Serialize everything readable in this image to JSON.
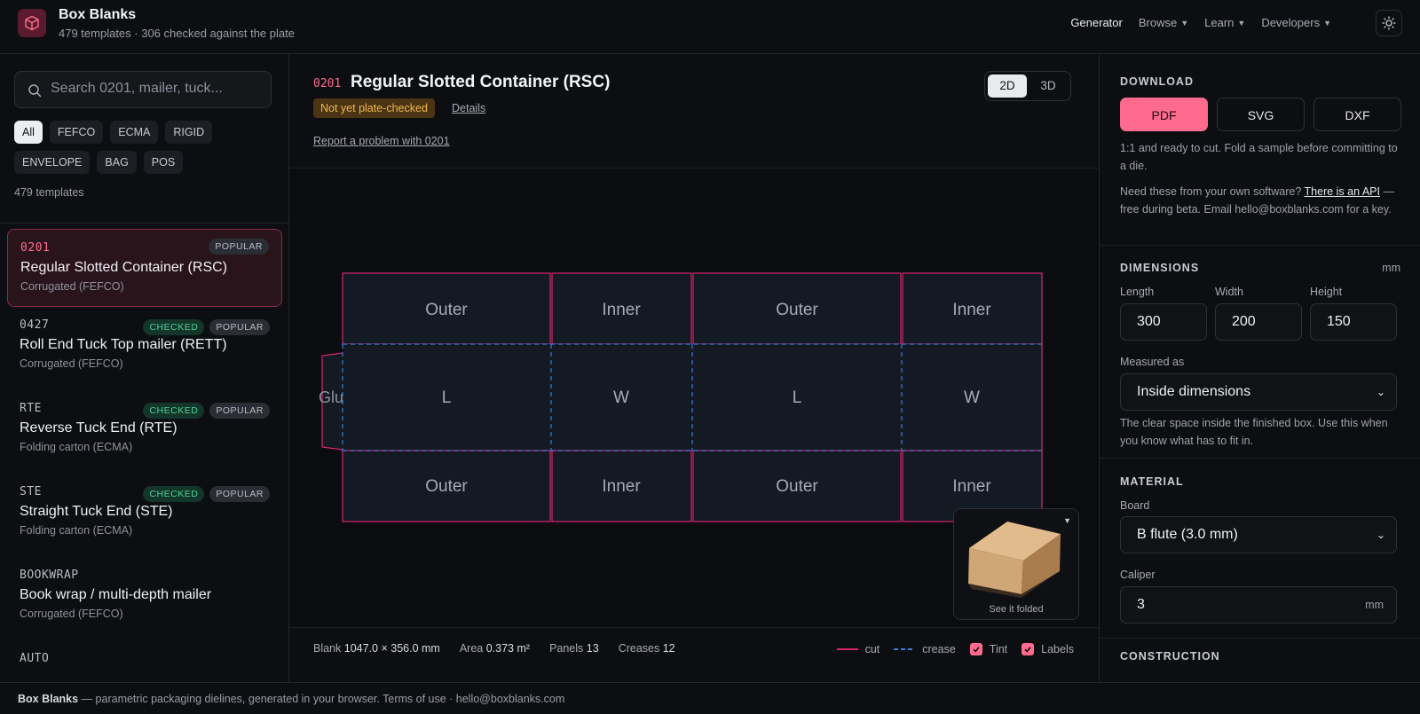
{
  "header": {
    "title": "Box Blanks",
    "subtitle": "479 templates · 306 checked against the plate",
    "nav": [
      {
        "label": "Generator",
        "active": true,
        "dropdown": false
      },
      {
        "label": "Browse",
        "dropdown": true
      },
      {
        "label": "Learn",
        "dropdown": true
      },
      {
        "label": "Developers",
        "dropdown": true
      }
    ],
    "theme_icon": "sun-icon"
  },
  "sidebar": {
    "search_placeholder": "Search 0201, mailer, tuck...",
    "filters": [
      "All",
      "FEFCO",
      "ECMA",
      "RIGID",
      "ENVELOPE",
      "BAG",
      "POS"
    ],
    "active_filter": "All",
    "count": "479 templates",
    "items": [
      {
        "code": "0201",
        "name": "Regular Slotted Container (RSC)",
        "category": "Corrugated (FEFCO)",
        "checked": "",
        "popular": "POPULAR",
        "selected": true
      },
      {
        "code": "0427",
        "name": "Roll End Tuck Top mailer (RETT)",
        "category": "Corrugated (FEFCO)",
        "checked": "CHECKED",
        "popular": "POPULAR"
      },
      {
        "code": "RTE",
        "name": "Reverse Tuck End (RTE)",
        "category": "Folding carton (ECMA)",
        "checked": "CHECKED",
        "popular": "POPULAR"
      },
      {
        "code": "STE",
        "name": "Straight Tuck End (STE)",
        "category": "Folding carton (ECMA)",
        "checked": "CHECKED",
        "popular": "POPULAR"
      },
      {
        "code": "BOOKWRAP",
        "name": "Book wrap / multi-depth mailer",
        "category": "Corrugated (FEFCO)",
        "checked": "",
        "popular": ""
      },
      {
        "code": "AUTO",
        "name": "",
        "category": "",
        "checked": "",
        "popular": ""
      }
    ]
  },
  "main": {
    "code": "0201",
    "title": "Regular Slotted Container (RSC)",
    "status_badge": "Not yet plate-checked",
    "details_link": "Details",
    "report_link": "Report a problem with 0201",
    "view_modes": [
      "2D",
      "3D"
    ],
    "active_view": "2D",
    "dieline": {
      "top_flaps": [
        "Outer",
        "Inner",
        "Outer",
        "Inner"
      ],
      "body_panels": [
        "L",
        "W",
        "L",
        "W"
      ],
      "bottom_flaps": [
        "Outer",
        "Inner",
        "Outer",
        "Inner"
      ],
      "glue_label": "Glue",
      "cut_color": "#d6266e",
      "crease_color": "#3a7bd5",
      "panel_fill": "#141a24"
    },
    "preview_caption": "See it folded",
    "stats": {
      "blank_label": "Blank",
      "blank_value": "1047.0 × 356.0 mm",
      "area_label": "Area",
      "area_value": "0.373 m²",
      "panels_label": "Panels",
      "panels_value": "13",
      "creases_label": "Creases",
      "creases_value": "12"
    },
    "legend": {
      "cut": "cut",
      "crease": "crease",
      "tint": "Tint",
      "labels": "Labels",
      "tint_checked": true,
      "labels_checked": true
    }
  },
  "panel": {
    "download_heading": "DOWNLOAD",
    "download_buttons": [
      "PDF",
      "SVG",
      "DXF"
    ],
    "download_note": "1:1 and ready to cut. Fold a sample before committing to a die.",
    "api_note_before": "Need these from your own software?",
    "api_link": "There is an API",
    "api_note_after": "— free during beta. Email hello@boxblanks.com for a key.",
    "dimensions_heading": "DIMENSIONS",
    "dimensions_unit": "mm",
    "length_label": "Length",
    "length_value": "300",
    "width_label": "Width",
    "width_value": "200",
    "height_label": "Height",
    "height_value": "150",
    "measured_label": "Measured as",
    "measured_value": "Inside dimensions",
    "measured_note": "The clear space inside the finished box. Use this when you know what has to fit in.",
    "material_heading": "MATERIAL",
    "board_label": "Board",
    "board_value": "B flute (3.0 mm)",
    "caliper_label": "Caliper",
    "caliper_value": "3",
    "caliper_unit": "mm",
    "construction_heading": "CONSTRUCTION",
    "accent": "#ff6b8f"
  },
  "footer": {
    "brand": "Box Blanks",
    "text": "— parametric packaging dielines, generated in your browser. Terms of use · hello@boxblanks.com"
  }
}
